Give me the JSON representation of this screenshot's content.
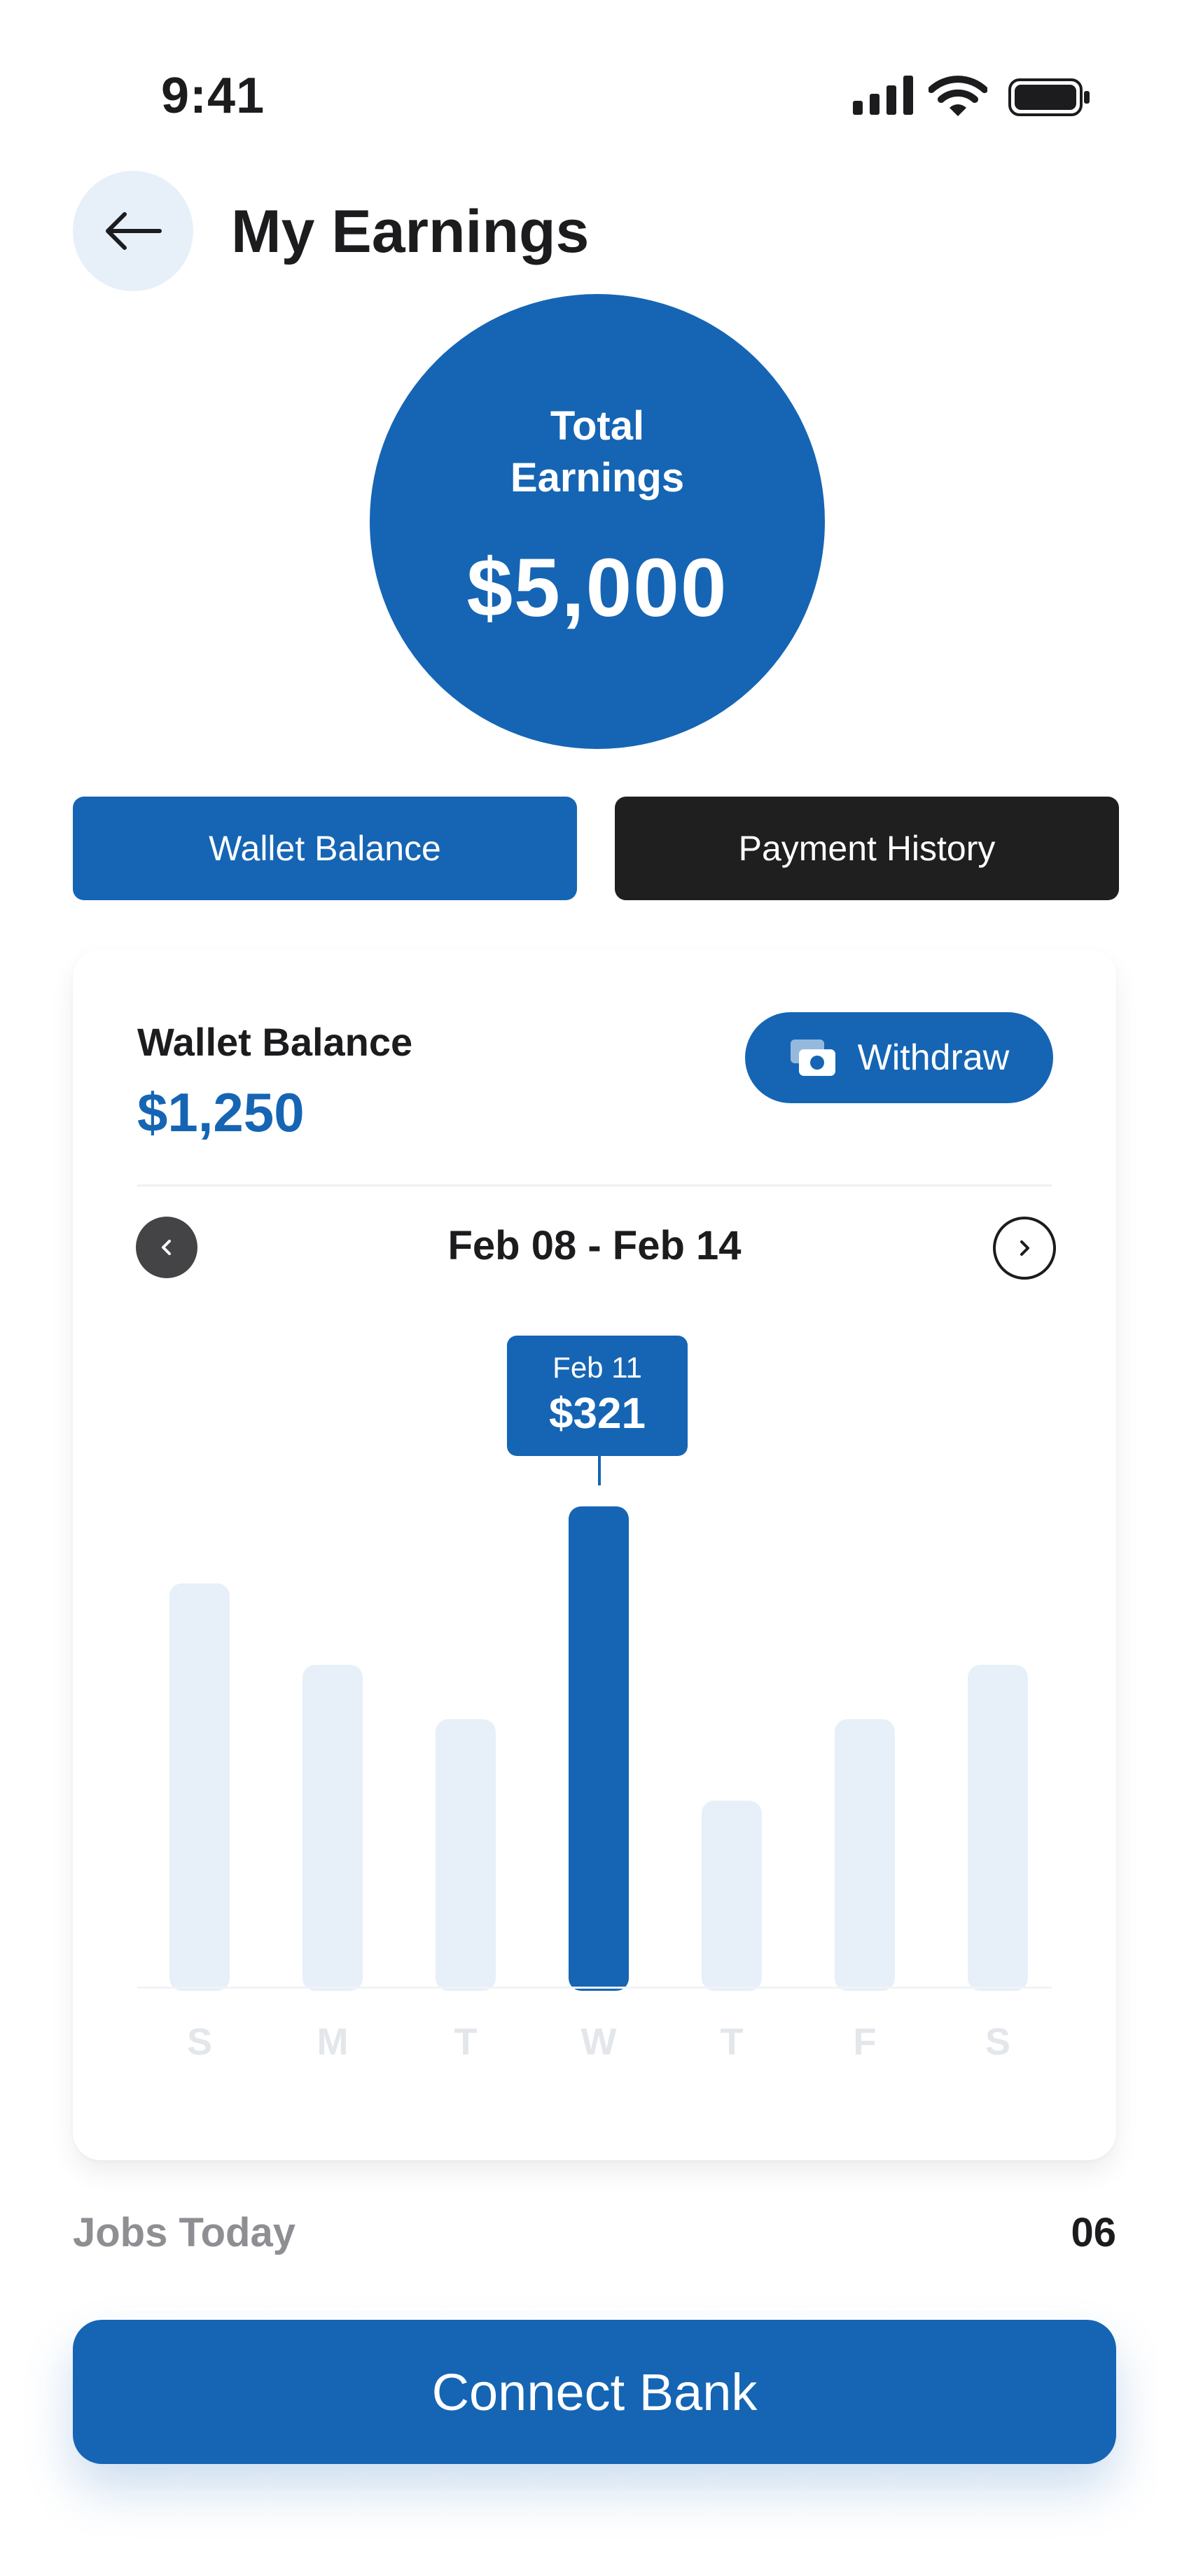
{
  "status_bar": {
    "time": "9:41",
    "icons": [
      "cellular-signal-icon",
      "wifi-icon",
      "battery-icon"
    ]
  },
  "header": {
    "back_icon": "arrow-left-icon",
    "title": "My Earnings"
  },
  "total_earnings": {
    "label_line1": "Total",
    "label_line2": "Earnings",
    "value": "$5,000"
  },
  "tabs": [
    {
      "label": "Wallet Balance",
      "active": true
    },
    {
      "label": "Payment History",
      "active": false
    }
  ],
  "wallet_card": {
    "label": "Wallet Balance",
    "value": "$1,250",
    "withdraw_label": "Withdraw",
    "withdraw_icon": "cash-icon",
    "date_range": "Feb 08 - Feb 14",
    "prev_icon": "chevron-left-icon",
    "next_icon": "chevron-right-icon"
  },
  "chart_data": {
    "type": "bar",
    "categories": [
      "S",
      "M",
      "T",
      "W",
      "T",
      "F",
      "S"
    ],
    "values": [
      270,
      216,
      180,
      321,
      126,
      180,
      216
    ],
    "ylim": [
      0,
      321
    ],
    "highlight_index": 3,
    "tooltip": {
      "date": "Feb 11",
      "value": "$321"
    },
    "grid": false,
    "colors": {
      "highlight": "#1565b4",
      "bar": "#e7f0f8"
    }
  },
  "jobs_today": {
    "label": "Jobs Today",
    "value": "06"
  },
  "connect_bank": {
    "label": "Connect Bank"
  },
  "colors": {
    "primary": "#1565b4",
    "dark": "#1f1f1f",
    "muted_text": "#8e8e93",
    "light_blue": "#e7f0f8"
  }
}
